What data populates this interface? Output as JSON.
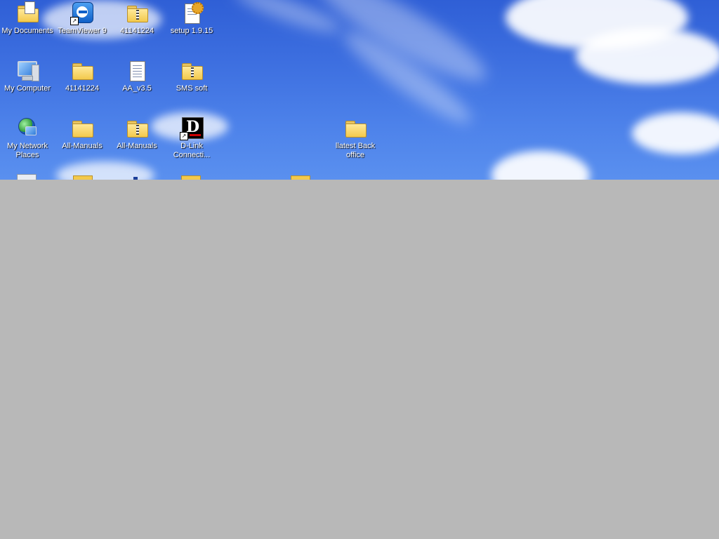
{
  "desktop": {
    "icons": [
      {
        "label": "My Documents",
        "icon": "my-documents-folder-icon"
      },
      {
        "label": "TeamViewer 9",
        "icon": "teamviewer-icon"
      },
      {
        "label": "41141224",
        "icon": "zip-folder-icon"
      },
      {
        "label": "setup 1.9.15",
        "icon": "setup-document-icon"
      },
      {
        "label": "My Computer",
        "icon": "computer-icon"
      },
      {
        "label": "41141224",
        "icon": "folder-icon"
      },
      {
        "label": "AA_v3.5",
        "icon": "document-icon"
      },
      {
        "label": "SMS soft",
        "icon": "zip-folder-icon"
      },
      {
        "label": "My Network Places",
        "icon": "network-globe-icon"
      },
      {
        "label": "All-Manuals",
        "icon": "folder-icon"
      },
      {
        "label": "All-Manuals",
        "icon": "zip-folder-icon"
      },
      {
        "label": "D-Link Connecti...",
        "icon": "dlink-icon"
      },
      {
        "label": "llatest Back office",
        "icon": "folder-icon"
      }
    ]
  },
  "colors": {
    "sky": "#3d6fe0",
    "background_gray": "#b8b8b8",
    "label_text": "#ffffff"
  }
}
